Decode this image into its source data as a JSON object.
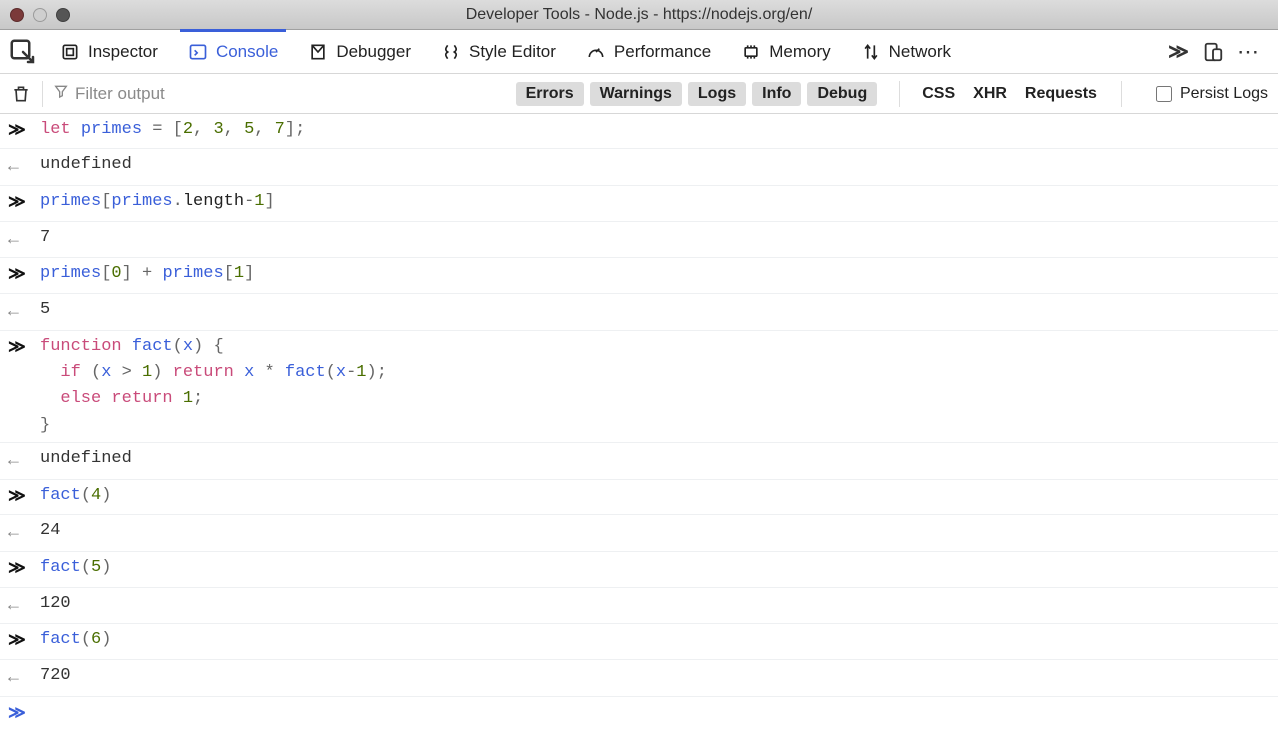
{
  "window": {
    "title": "Developer Tools - Node.js - https://nodejs.org/en/"
  },
  "tabs": {
    "inspector": "Inspector",
    "console": "Console",
    "debugger": "Debugger",
    "style_editor": "Style Editor",
    "performance": "Performance",
    "memory": "Memory",
    "network": "Network"
  },
  "toolbar": {
    "filter_placeholder": "Filter output",
    "levels": {
      "errors": "Errors",
      "warnings": "Warnings",
      "logs": "Logs",
      "info": "Info",
      "debug": "Debug"
    },
    "sources": {
      "css": "CSS",
      "xhr": "XHR",
      "requests": "Requests"
    },
    "persist_label": "Persist Logs"
  },
  "entries": [
    {
      "type": "input",
      "tokens": [
        {
          "t": "let",
          "c": "kw"
        },
        {
          "t": " ",
          "c": "op"
        },
        {
          "t": "primes",
          "c": "name"
        },
        {
          "t": " = [",
          "c": "op"
        },
        {
          "t": "2",
          "c": "num"
        },
        {
          "t": ", ",
          "c": "op"
        },
        {
          "t": "3",
          "c": "num"
        },
        {
          "t": ", ",
          "c": "op"
        },
        {
          "t": "5",
          "c": "num"
        },
        {
          "t": ", ",
          "c": "op"
        },
        {
          "t": "7",
          "c": "num"
        },
        {
          "t": "];",
          "c": "op"
        }
      ]
    },
    {
      "type": "output",
      "text": "undefined"
    },
    {
      "type": "input",
      "tokens": [
        {
          "t": "primes",
          "c": "name"
        },
        {
          "t": "[",
          "c": "op"
        },
        {
          "t": "primes",
          "c": "name"
        },
        {
          "t": ".",
          "c": "op"
        },
        {
          "t": "length",
          "c": "prop"
        },
        {
          "t": "-",
          "c": "op"
        },
        {
          "t": "1",
          "c": "num"
        },
        {
          "t": "]",
          "c": "op"
        }
      ]
    },
    {
      "type": "output",
      "text": "7"
    },
    {
      "type": "input",
      "tokens": [
        {
          "t": "primes",
          "c": "name"
        },
        {
          "t": "[",
          "c": "op"
        },
        {
          "t": "0",
          "c": "num"
        },
        {
          "t": "] + ",
          "c": "op"
        },
        {
          "t": "primes",
          "c": "name"
        },
        {
          "t": "[",
          "c": "op"
        },
        {
          "t": "1",
          "c": "num"
        },
        {
          "t": "]",
          "c": "op"
        }
      ]
    },
    {
      "type": "output",
      "text": "5"
    },
    {
      "type": "input",
      "tokens": [
        {
          "t": "function",
          "c": "kw"
        },
        {
          "t": " ",
          "c": "op"
        },
        {
          "t": "fact",
          "c": "name"
        },
        {
          "t": "(",
          "c": "op"
        },
        {
          "t": "x",
          "c": "name"
        },
        {
          "t": ") {",
          "c": "op"
        },
        {
          "t": "\n  ",
          "c": "op"
        },
        {
          "t": "if",
          "c": "kw"
        },
        {
          "t": " (",
          "c": "op"
        },
        {
          "t": "x",
          "c": "name"
        },
        {
          "t": " > ",
          "c": "op"
        },
        {
          "t": "1",
          "c": "num"
        },
        {
          "t": ") ",
          "c": "op"
        },
        {
          "t": "return",
          "c": "kw"
        },
        {
          "t": " ",
          "c": "op"
        },
        {
          "t": "x",
          "c": "name"
        },
        {
          "t": " * ",
          "c": "op"
        },
        {
          "t": "fact",
          "c": "name"
        },
        {
          "t": "(",
          "c": "op"
        },
        {
          "t": "x",
          "c": "name"
        },
        {
          "t": "-",
          "c": "op"
        },
        {
          "t": "1",
          "c": "num"
        },
        {
          "t": ");",
          "c": "op"
        },
        {
          "t": "\n  ",
          "c": "op"
        },
        {
          "t": "else",
          "c": "kw"
        },
        {
          "t": " ",
          "c": "op"
        },
        {
          "t": "return",
          "c": "kw"
        },
        {
          "t": " ",
          "c": "op"
        },
        {
          "t": "1",
          "c": "num"
        },
        {
          "t": ";",
          "c": "op"
        },
        {
          "t": "\n}",
          "c": "op"
        }
      ]
    },
    {
      "type": "output",
      "text": "undefined"
    },
    {
      "type": "input",
      "tokens": [
        {
          "t": "fact",
          "c": "name"
        },
        {
          "t": "(",
          "c": "op"
        },
        {
          "t": "4",
          "c": "num"
        },
        {
          "t": ")",
          "c": "op"
        }
      ]
    },
    {
      "type": "output",
      "text": "24"
    },
    {
      "type": "input",
      "tokens": [
        {
          "t": "fact",
          "c": "name"
        },
        {
          "t": "(",
          "c": "op"
        },
        {
          "t": "5",
          "c": "num"
        },
        {
          "t": ")",
          "c": "op"
        }
      ]
    },
    {
      "type": "output",
      "text": "120"
    },
    {
      "type": "input",
      "tokens": [
        {
          "t": "fact",
          "c": "name"
        },
        {
          "t": "(",
          "c": "op"
        },
        {
          "t": "6",
          "c": "num"
        },
        {
          "t": ")",
          "c": "op"
        }
      ]
    },
    {
      "type": "output",
      "text": "720"
    }
  ]
}
